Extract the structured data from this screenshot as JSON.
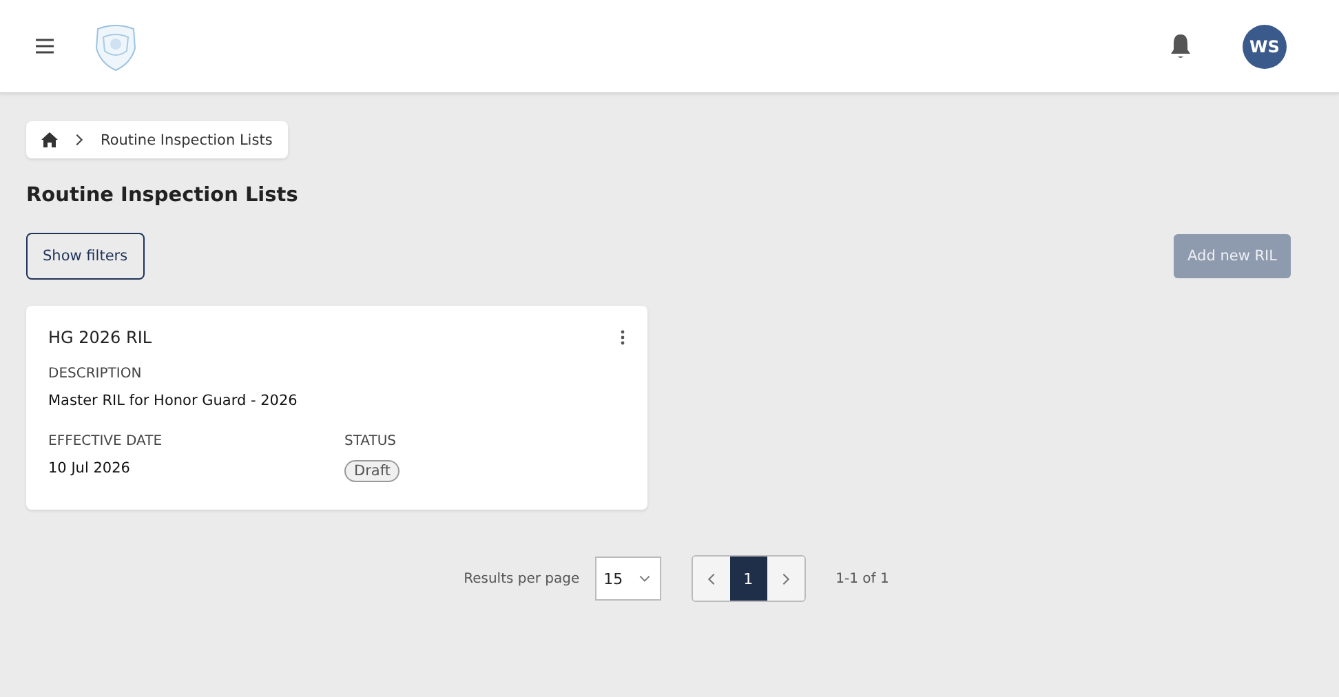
{
  "header": {
    "avatar": "WS"
  },
  "breadcrumb": [
    "Routine Inspection Lists"
  ],
  "title": "Routine Inspection Lists",
  "toolbar": {
    "filters_button": "Show filters",
    "add_button": {
      "label": "Add new RIL",
      "disabled": true
    }
  },
  "cards": [
    {
      "title": "HG 2026 RIL",
      "description_label": "DESCRIPTION",
      "description": "Master RIL for Honor Guard - 2026",
      "date_label": "EFFECTIVE DATE",
      "date": "10 Jul 2026",
      "status_label": "STATUS",
      "status": "Draft"
    }
  ],
  "pagination": {
    "per_page_label": "Results per page",
    "per_page": "15",
    "pages": [
      {
        "label": "1",
        "selected": true
      }
    ],
    "range": "1-1 of 1"
  }
}
